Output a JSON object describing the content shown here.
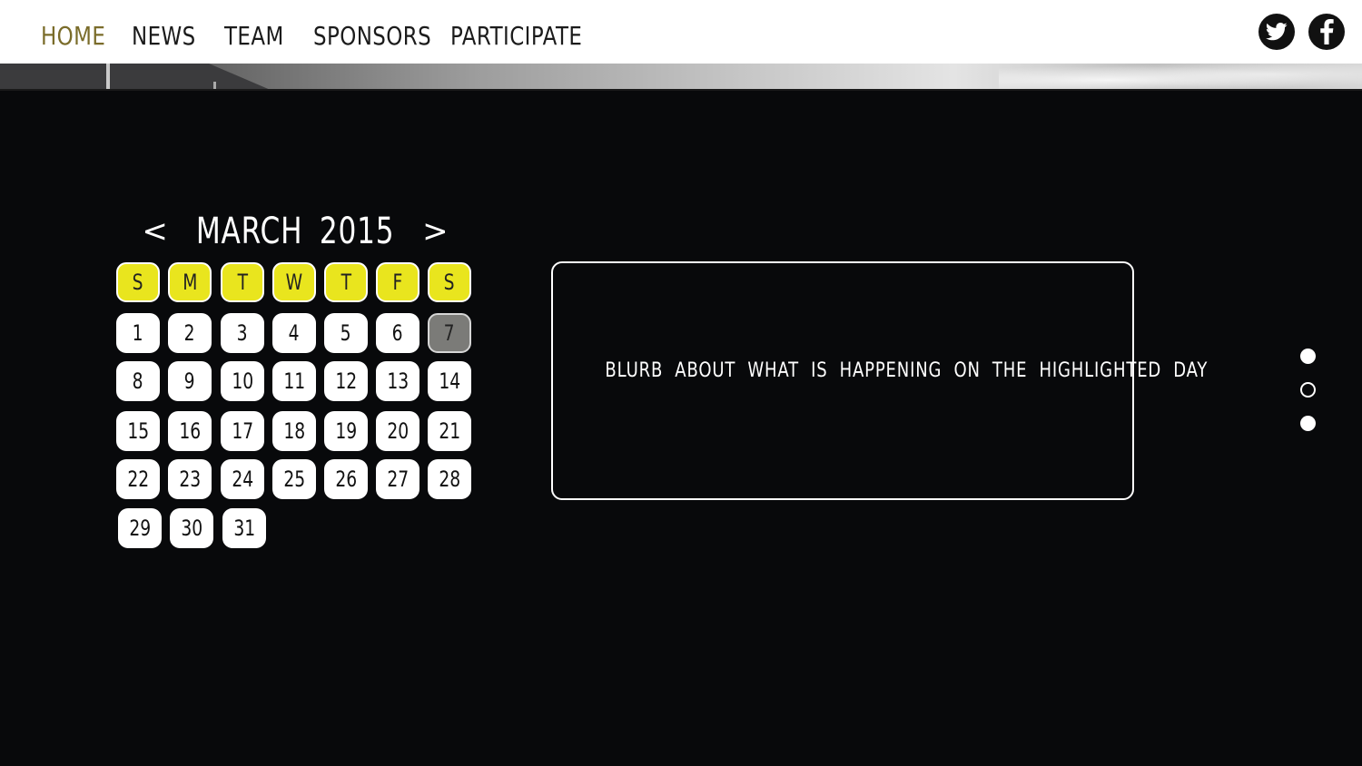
{
  "nav": {
    "items": [
      {
        "label": "HOME",
        "active": true
      },
      {
        "label": "NEWS",
        "active": false
      },
      {
        "label": "TEAM",
        "active": false
      },
      {
        "label": "SPONSORS",
        "active": false
      },
      {
        "label": "PARTICIPATE",
        "active": false
      }
    ],
    "social": [
      {
        "icon": "twitter-icon"
      },
      {
        "icon": "facebook-icon"
      }
    ]
  },
  "calendar": {
    "month_label": "MARCH 2015",
    "prev_label": "<",
    "next_label": ">",
    "weekdays": [
      "S",
      "M",
      "T",
      "W",
      "T",
      "F",
      "S"
    ],
    "days": [
      "1",
      "2",
      "3",
      "4",
      "5",
      "6",
      "7",
      "8",
      "9",
      "10",
      "11",
      "12",
      "13",
      "14",
      "15",
      "16",
      "17",
      "18",
      "19",
      "20",
      "21",
      "22",
      "23",
      "24",
      "25",
      "26",
      "27",
      "28",
      "29",
      "30",
      "31"
    ],
    "selected_day": "7"
  },
  "info": {
    "blurb": "BLURB ABOUT WHAT IS HAPPENING ON THE HIGHLIGHTED DAY"
  },
  "pager": {
    "dots": [
      "filled",
      "hollow",
      "filled"
    ],
    "active_index": 1
  },
  "colors": {
    "accent_yellow": "#e9e51e",
    "active_nav": "#7a6c2a",
    "background": "#08090b",
    "selected_day": "#7b7b78"
  }
}
